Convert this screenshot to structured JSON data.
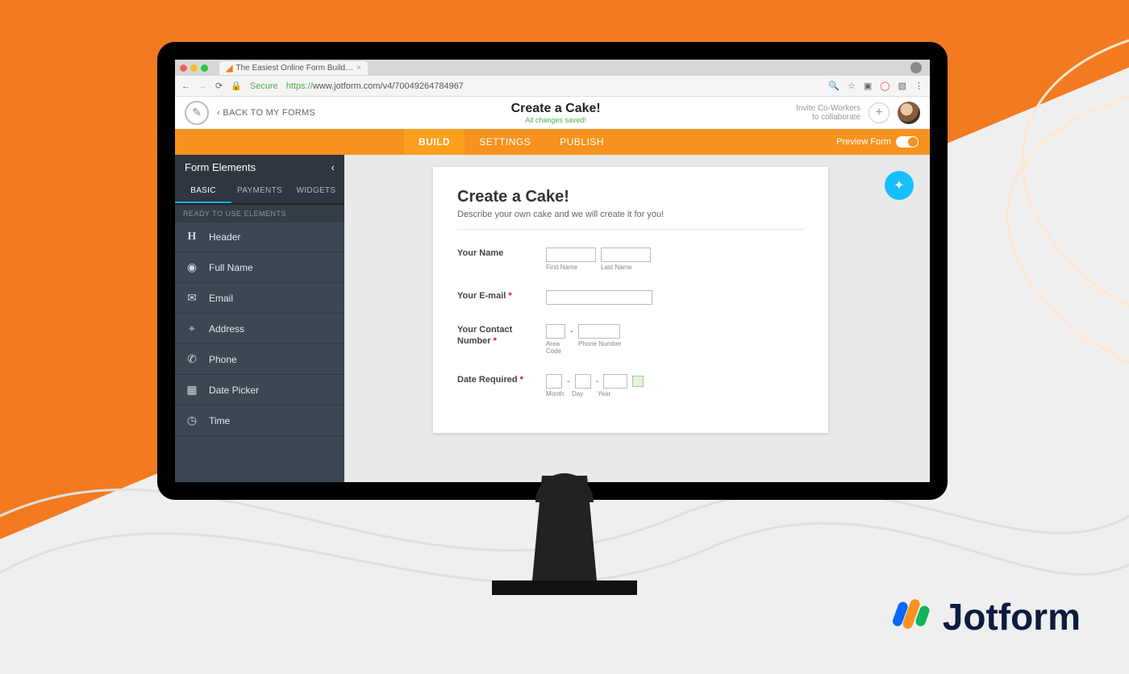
{
  "browser": {
    "tab_title": "The Easiest Online Form Build…",
    "tab_close": "×",
    "secure_label": "Secure",
    "url_https": "https://",
    "url_rest": "www.jotform.com/v4/70049264784967"
  },
  "header": {
    "back": "BACK TO MY FORMS",
    "title": "Create a Cake!",
    "subtitle": "All changes saved!",
    "invite_line1": "Invite Co-Workers",
    "invite_line2": "to collaborate"
  },
  "nav": {
    "build": "BUILD",
    "settings": "SETTINGS",
    "publish": "PUBLISH",
    "preview": "Preview Form"
  },
  "sidebar": {
    "title": "Form Elements",
    "tabs": {
      "basic": "BASIC",
      "payments": "PAYMENTS",
      "widgets": "WIDGETS"
    },
    "section": "READY TO USE ELEMENTS",
    "items": [
      {
        "label": "Header"
      },
      {
        "label": "Full Name"
      },
      {
        "label": "Email"
      },
      {
        "label": "Address"
      },
      {
        "label": "Phone"
      },
      {
        "label": "Date Picker"
      },
      {
        "label": "Time"
      }
    ]
  },
  "form": {
    "title": "Create a Cake!",
    "subtitle": "Describe your own cake and we will create it for you!",
    "fields": {
      "name": {
        "label": "Your Name",
        "sub1": "First Name",
        "sub2": "Last Name"
      },
      "email": {
        "label": "Your E-mail"
      },
      "phone": {
        "label": "Your Contact Number",
        "sub1": "Area Code",
        "sub2": "Phone Number"
      },
      "date": {
        "label": "Date Required",
        "sub1": "Month",
        "sub2": "Day",
        "sub3": "Year"
      }
    },
    "asterisk": "*"
  },
  "brand": {
    "name": "Jotform"
  }
}
